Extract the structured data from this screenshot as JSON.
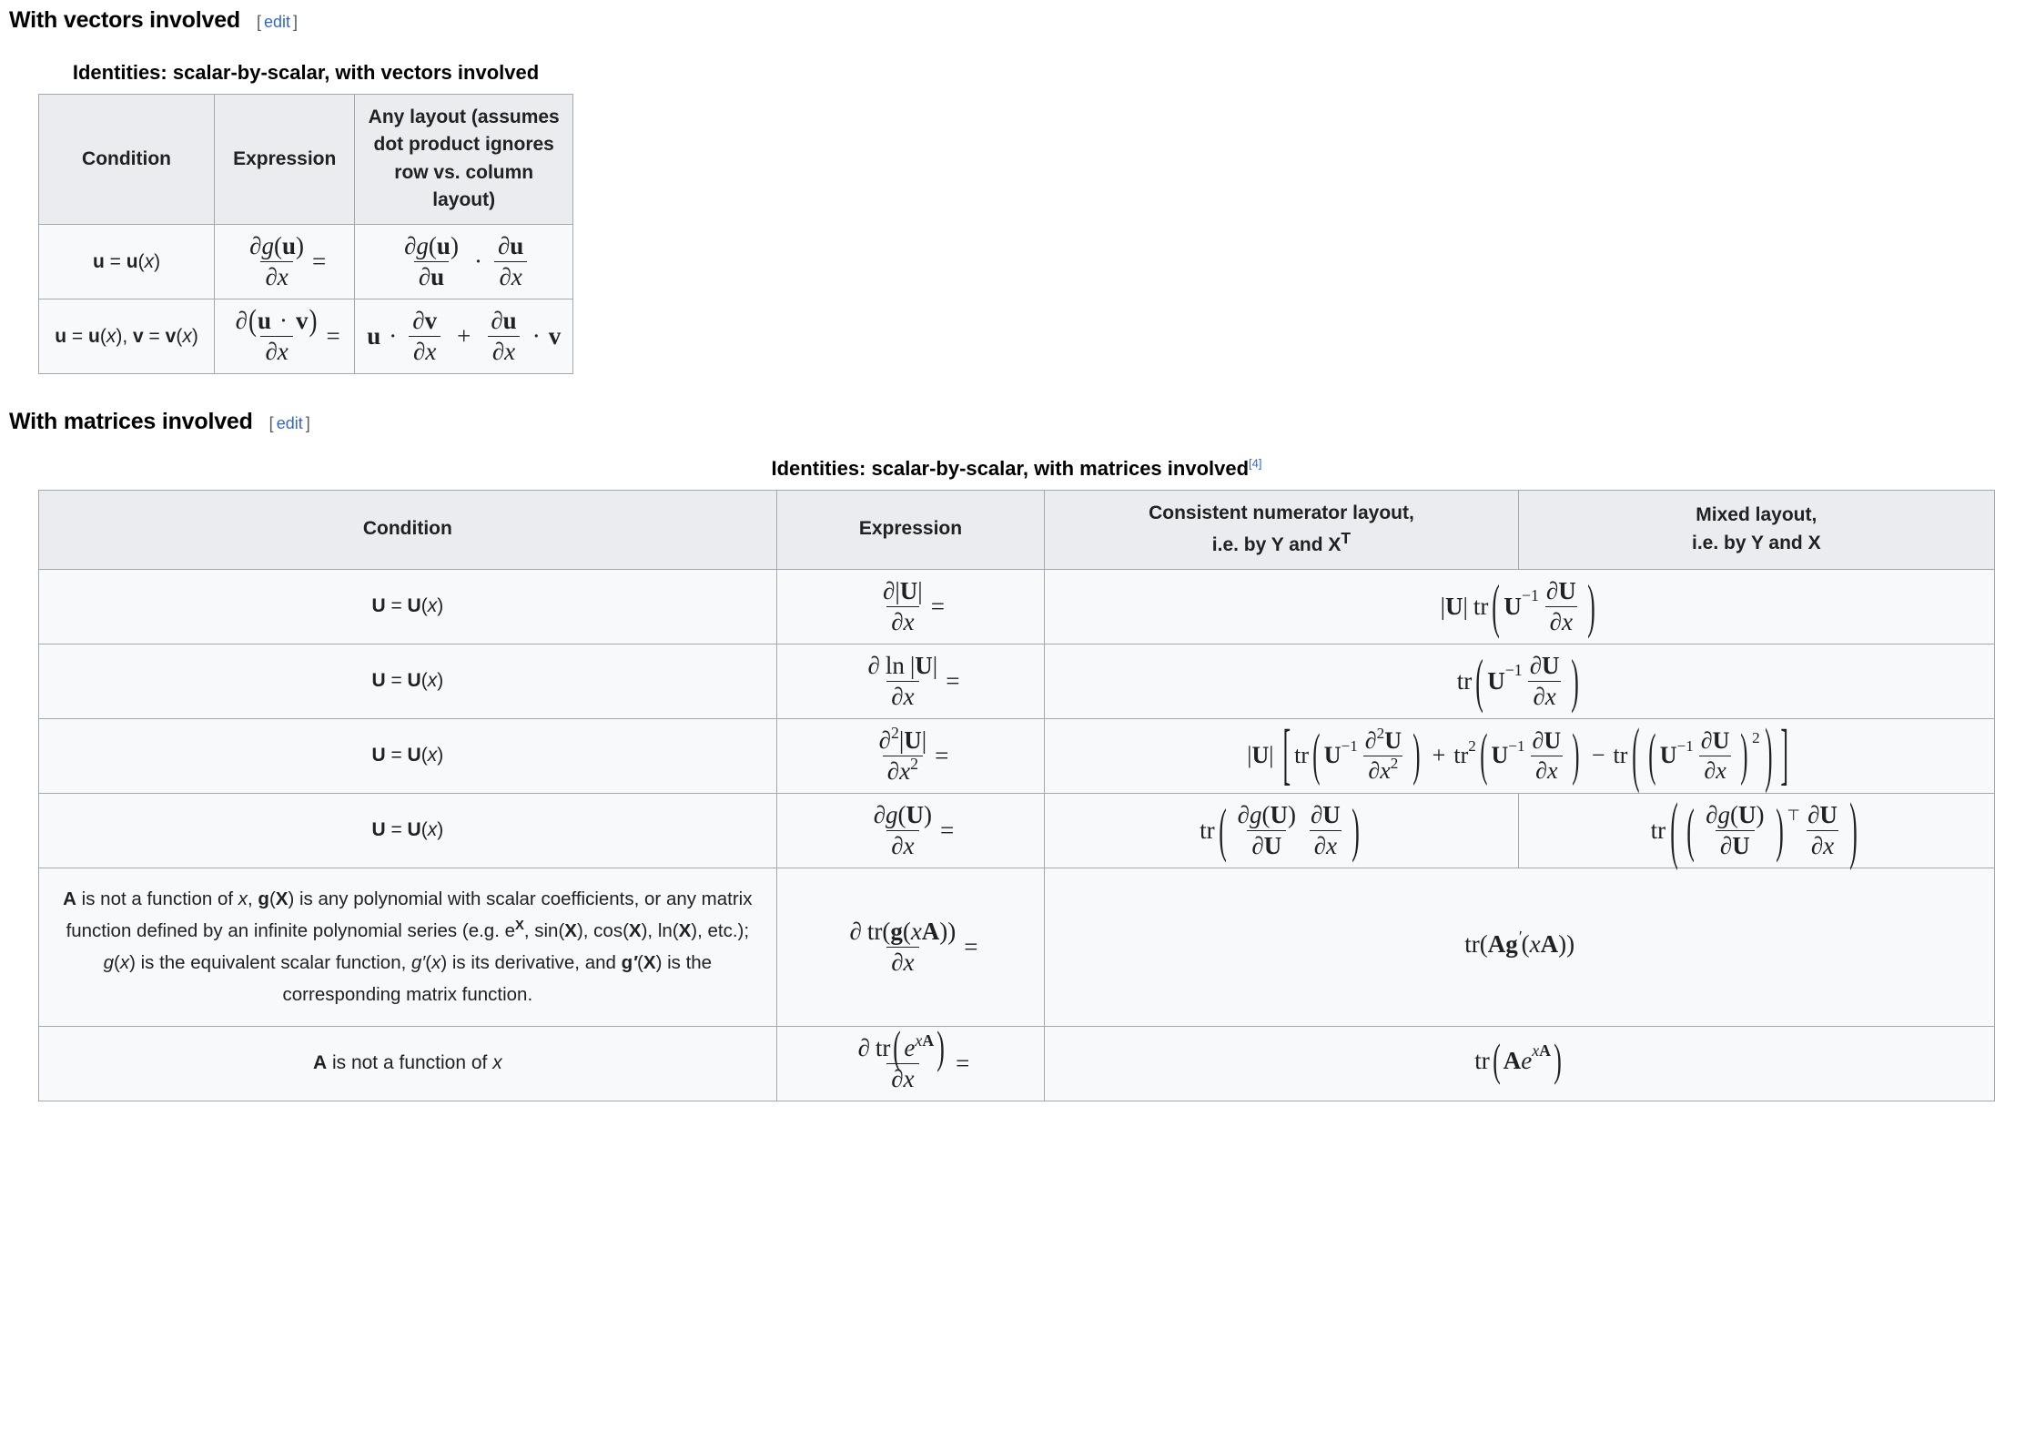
{
  "sections": [
    {
      "id": "vectors",
      "heading": "With vectors involved",
      "edit_label": "edit",
      "edit_bracket_open": "[",
      "edit_bracket_close": "]"
    },
    {
      "id": "matrices",
      "heading": "With matrices involved",
      "edit_label": "edit",
      "edit_bracket_open": "[",
      "edit_bracket_close": "]"
    }
  ],
  "table_vectors": {
    "caption": "Identities: scalar-by-scalar, with vectors involved",
    "headers": {
      "condition": "Condition",
      "expression": "Expression",
      "any_layout": "Any layout (assumes dot product ignores row vs. column layout)"
    },
    "rows": [
      {
        "condition_tex": "u = u(x)",
        "expression_tex": "\\frac{\\partial g(\\mathbf{u})}{\\partial x} =",
        "result_tex": "\\frac{\\partial g(\\mathbf{u})}{\\partial \\mathbf{u}} \\cdot \\frac{\\partial \\mathbf{u}}{\\partial x}"
      },
      {
        "condition_tex": "u = u(x), v = v(x)",
        "expression_tex": "\\frac{\\partial(\\mathbf{u}\\cdot\\mathbf{v})}{\\partial x} =",
        "result_tex": "\\mathbf{u} \\cdot \\frac{\\partial \\mathbf{v}}{\\partial x} + \\frac{\\partial \\mathbf{u}}{\\partial x} \\cdot \\mathbf{v}"
      }
    ]
  },
  "table_matrices": {
    "caption": "Identities: scalar-by-scalar, with matrices involved",
    "caption_ref": "[4]",
    "headers": {
      "condition": "Condition",
      "expression": "Expression",
      "consistent_line1": "Consistent numerator layout,",
      "consistent_line2": "i.e. by Y and X",
      "consistent_line2_sup": "T",
      "mixed_line1": "Mixed layout,",
      "mixed_line2": "i.e. by Y and X"
    },
    "rows": [
      {
        "condition_tex": "U = U(x)",
        "expression_tex": "\\frac{\\partial |\\mathbf{U}|}{\\partial x} =",
        "result_consistent_tex": "|\\mathbf{U}|\\,\\operatorname{tr}\\!\\left(\\mathbf{U}^{-1}\\frac{\\partial\\mathbf{U}}{\\partial x}\\right)",
        "spans_both": true
      },
      {
        "condition_tex": "U = U(x)",
        "expression_tex": "\\frac{\\partial \\ln |\\mathbf{U}|}{\\partial x} =",
        "result_consistent_tex": "\\operatorname{tr}\\!\\left(\\mathbf{U}^{-1}\\frac{\\partial\\mathbf{U}}{\\partial x}\\right)",
        "spans_both": true
      },
      {
        "condition_tex": "U = U(x)",
        "expression_tex": "\\frac{\\partial^2 |\\mathbf{U}|}{\\partial x^2} =",
        "result_consistent_tex": "|\\mathbf{U}|\\left[\\operatorname{tr}\\!\\left(\\mathbf{U}^{-1}\\frac{\\partial^2\\mathbf{U}}{\\partial x^2}\\right)+\\operatorname{tr}^2\\!\\left(\\mathbf{U}^{-1}\\frac{\\partial\\mathbf{U}}{\\partial x}\\right)-\\operatorname{tr}\\!\\left(\\left(\\mathbf{U}^{-1}\\frac{\\partial\\mathbf{U}}{\\partial x}\\right)^2\\right)\\right]",
        "spans_both": true
      },
      {
        "condition_tex": "U = U(x)",
        "expression_tex": "\\frac{\\partial g(\\mathbf{U})}{\\partial x} =",
        "result_consistent_tex": "\\operatorname{tr}\\!\\left(\\frac{\\partial g(\\mathbf{U})}{\\partial\\mathbf{U}}\\frac{\\partial\\mathbf{U}}{\\partial x}\\right)",
        "result_mixed_tex": "\\operatorname{tr}\\!\\left(\\left(\\frac{\\partial g(\\mathbf{U})}{\\partial\\mathbf{U}}\\right)^{\\!\\top}\\frac{\\partial\\mathbf{U}}{\\partial x}\\right)",
        "spans_both": false
      },
      {
        "condition_text": "A is not a function of x, g(X) is any polynomial with scalar coefficients, or any matrix function defined by an infinite polynomial series (e.g. eX, sin(X), cos(X), ln(X), etc.); g(x) is the equivalent scalar function, g′(x) is its derivative, and g′(X) is the corresponding matrix function.",
        "expression_tex": "\\frac{\\partial \\operatorname{tr}(\\mathbf{g}(x\\mathbf{A}))}{\\partial x} =",
        "result_consistent_tex": "\\operatorname{tr}(\\mathbf{A}\\mathbf{g}'(x\\mathbf{A}))",
        "spans_both": true
      },
      {
        "condition_tex": "A is not a function of x",
        "expression_tex": "\\frac{\\partial \\operatorname{tr}\\!\\left(e^{x\\mathbf{A}}\\right)}{\\partial x} =",
        "result_consistent_tex": "\\operatorname{tr}\\!\\left(\\mathbf{A}e^{x\\mathbf{A}}\\right)",
        "spans_both": true
      }
    ]
  },
  "colors": {
    "link": "#3366cc",
    "table_border": "#a2a9b1",
    "header_bg": "#eaecf0",
    "cell_bg": "#f8f9fa",
    "text": "#202122"
  }
}
